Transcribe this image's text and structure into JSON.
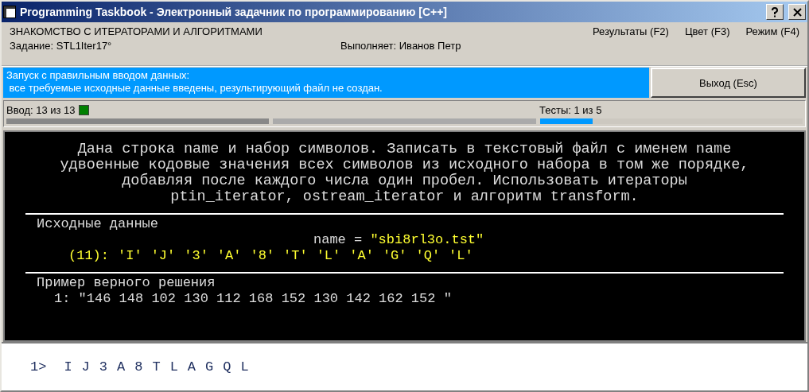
{
  "window": {
    "title": "Programming Taskbook - Электронный задачник по программированию [C++]"
  },
  "header": {
    "topic": "ЗНАКОМСТВО С ИТЕРАТОРАМИ И АЛГОРИТМАМИ",
    "task": "Задание: STL1Iter17°",
    "student": "Выполняет: Иванов Петр",
    "menu": [
      {
        "label": "Результаты (F2)"
      },
      {
        "label": "Цвет (F3)"
      },
      {
        "label": "Режим (F4)"
      }
    ]
  },
  "status": {
    "lines": [
      "Запуск с правильным вводом данных:",
      " все требуемые исходные данные введены, результирующий файл не создан."
    ],
    "exit_button": "Выход (Esc)"
  },
  "progress": {
    "input_label": "Ввод: 13 из 13",
    "input_done": true,
    "tests_label": "Тесты: 1 из 5",
    "segments": [
      {
        "done": true
      },
      {
        "done": false
      }
    ],
    "tests": {
      "level": 0.2
    }
  },
  "task_text": [
    "Дана строка name и набор символов. Записать в текстовый файл с именем name",
    "удвоенные кодовые значения всех символов из исходного набора в том же порядке,",
    "добавляя после каждого числа один пробел. Использовать итераторы",
    "ptin_iterator, ostream_iterator и алгоритм transform."
  ],
  "input_data": {
    "title": "Исходные данные",
    "name_label": "name = ",
    "name_value": "\"sbi8rl3o.tst\"",
    "count": "(11):",
    "chars": [
      "'I'",
      "'J'",
      "'3'",
      "'A'",
      "'8'",
      "'T'",
      "'L'",
      "'A'",
      "'G'",
      "'Q'",
      "'L'"
    ]
  },
  "example": {
    "title": "Пример верного решения",
    "lines": [
      "1: \"146 148 102 130 112 168 152 130 142 162 152 \""
    ]
  },
  "output": {
    "prompt": "1>",
    "chars": [
      "I",
      "J",
      "3",
      "A",
      "8",
      "T",
      "L",
      "A",
      "G",
      "Q",
      "L"
    ]
  }
}
